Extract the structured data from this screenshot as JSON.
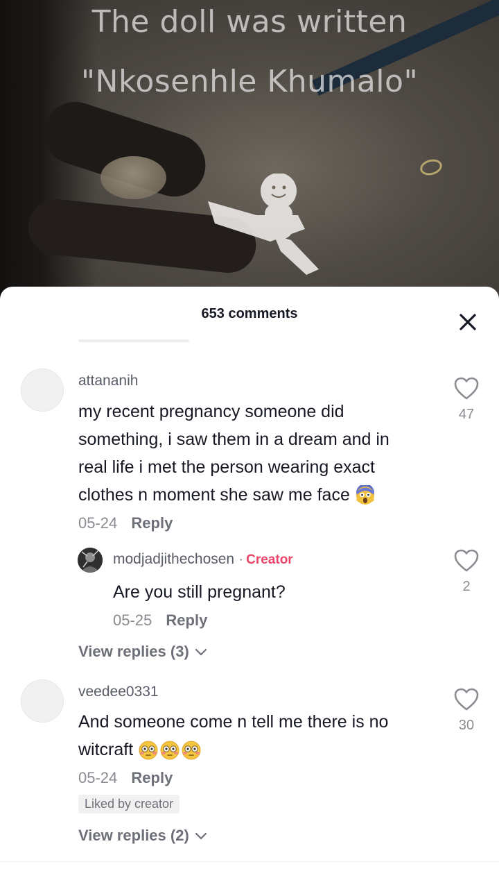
{
  "video": {
    "caption_line1": "The doll was written",
    "caption_line2": "\"Nkosenhle Khumalo\""
  },
  "sheet": {
    "title": "653 comments"
  },
  "comments": [
    {
      "username": "attananih",
      "lines": [
        "my recent pregnancy someone did",
        "something, i saw them in a dream and in",
        "real life i met the person wearing exact",
        "clothes n moment she saw me face"
      ],
      "emoji": "scream-emoji",
      "date": "05-24",
      "reply_label": "Reply",
      "likes": "47",
      "reply": {
        "username": "modjadjithechosen",
        "separator": "·",
        "badge": "Creator",
        "text": "Are you still pregnant?",
        "date": "05-25",
        "reply_label": "Reply",
        "likes": "2"
      },
      "view_replies": "View replies (3)"
    },
    {
      "username": "veedee0331",
      "lines": [
        "And someone come n tell me there is no",
        "witcraft"
      ],
      "emoji": "flushed-emoji x3",
      "date": "05-24",
      "reply_label": "Reply",
      "likes": "30",
      "liked_by": "Liked by creator",
      "view_replies": "View replies (2)"
    }
  ],
  "colors": {
    "creator": "#ea4468",
    "text": "#161823",
    "muted": "#8a8b91"
  }
}
